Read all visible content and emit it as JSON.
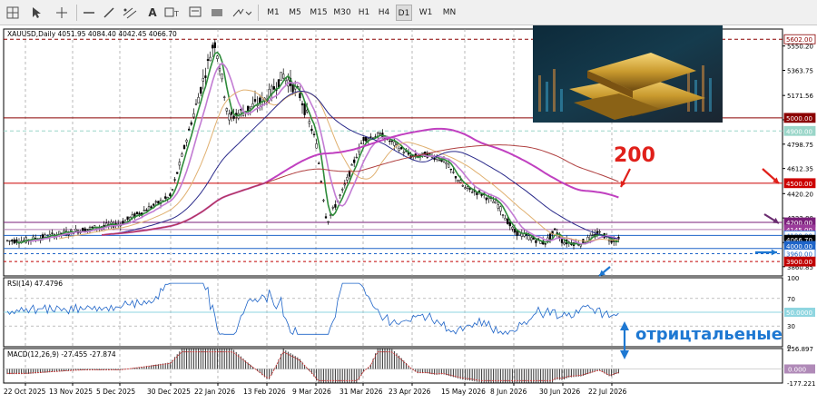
{
  "toolbar": {
    "timeframes": [
      "M1",
      "M5",
      "M15",
      "M30",
      "H1",
      "H4",
      "D1",
      "W1",
      "MN"
    ],
    "active_timeframe": "D1",
    "tool_icons": [
      "grid-icon",
      "cursor-icon",
      "crosshair-icon",
      "hline-icon",
      "trendline-icon",
      "channel-icon",
      "text-icon",
      "shapes-icon",
      "arrow-tool-icon"
    ]
  },
  "chart_header": {
    "symbol_line": "XAUUSD,Daily  4051.95 4084.40 4042.45 4066.70"
  },
  "annotations": {
    "ma_label": "200",
    "side_note": "отрицтальеные"
  },
  "colors": {
    "background": "#ffffff",
    "candle": "#000000",
    "red_line": "#c00000",
    "purple_line": "#800080",
    "level_5000": "#8b0000",
    "level_4500": "#cc0000",
    "level_4200": "#7a1f7a",
    "level_4900": "#9ad6c9",
    "blue_level": "#1e64c8",
    "annotation_red": "#e0201a",
    "annotation_blue": "#1e78d2",
    "annotation_purple": "#6a2c70"
  },
  "price_axis": {
    "ticks": [
      "5550.20",
      "5363.75",
      "5171.56",
      "4985.35",
      "4798.75",
      "4612.35",
      "4420.20",
      "4233.80",
      "4045.40",
      "3860.85"
    ],
    "badges": [
      {
        "text": "5602.00",
        "bg": "#ffffff",
        "fg": "#8b0000",
        "border": "#8b0000"
      },
      {
        "text": "5000.00",
        "bg": "#8b0000",
        "fg": "#ffffff",
        "border": "#8b0000"
      },
      {
        "text": "4900.00",
        "bg": "#9ad6c9",
        "fg": "#ffffff",
        "border": "#9ad6c9"
      },
      {
        "text": "4500.00",
        "bg": "#cc0000",
        "fg": "#ffffff",
        "border": "#cc0000"
      },
      {
        "text": "4200.00",
        "bg": "#7a1f7a",
        "fg": "#ffffff",
        "border": "#7a1f7a"
      },
      {
        "text": "4145.00",
        "bg": "#9a3b9a",
        "fg": "#ffffff",
        "border": "#9a3b9a"
      },
      {
        "text": "4100.00",
        "bg": "#ffffff",
        "fg": "#1e64c8",
        "border": "#1e64c8"
      },
      {
        "text": "4066.70",
        "bg": "#000000",
        "fg": "#ffffff",
        "border": "#000000"
      },
      {
        "text": "4000.00",
        "bg": "#1e64c8",
        "fg": "#ffffff",
        "border": "#1e64c8"
      },
      {
        "text": "3960.00",
        "bg": "#ffffff",
        "fg": "#1e64c8",
        "border": "#1e64c8"
      },
      {
        "text": "3900.00",
        "bg": "#c00000",
        "fg": "#ffffff",
        "border": "#c00000"
      }
    ]
  },
  "rsi": {
    "label": "RSI(14) 47.4796",
    "ticks": [
      "100",
      "70",
      "30",
      "0"
    ],
    "level_badge": "50.0000"
  },
  "macd": {
    "label": "MACD(12,26,9) -27.455 -27.874",
    "ticks": [
      "256.897",
      "-177.221"
    ],
    "zero_badge": "0.000"
  },
  "time_axis": {
    "labels": [
      "22 Oct 2025",
      "13 Nov 2025",
      "5 Dec 2025",
      "30 Dec 2025",
      "22 Jan 2026",
      "13 Feb 2026",
      "9 Mar 2026",
      "31 Mar 2026",
      "23 Apr 2026",
      "15 May 2026",
      "8 Jun 2026",
      "30 Jun 2026",
      "22 Jul 2026"
    ]
  },
  "chart_data": {
    "type": "candlestick",
    "symbol": "XAUUSD",
    "timeframe": "Daily",
    "ohlc_last": {
      "open": 4051.95,
      "high": 4084.4,
      "low": 4042.45,
      "close": 4066.7
    },
    "ylim": [
      3790,
      5680
    ],
    "horizontal_levels": [
      5602,
      5000,
      4900,
      4500,
      4200,
      4145,
      4100,
      4000,
      3960,
      3900
    ],
    "close_series": {
      "x": [
        "22 Oct 2025",
        "13 Nov 2025",
        "5 Dec 2025",
        "30 Dec 2025",
        "22 Jan 2026",
        "13 Feb 2026",
        "9 Mar 2026",
        "31 Mar 2026",
        "23 Apr 2026",
        "15 May 2026",
        "8 Jun 2026",
        "30 Jun 2026",
        "22 Jul 2026"
      ],
      "y": [
        4060,
        4130,
        4190,
        4400,
        5480,
        5150,
        4820,
        4840,
        4700,
        4460,
        4130,
        4050,
        4066.7
      ]
    },
    "rsi": {
      "value": 47.4796,
      "range": [
        0,
        100
      ],
      "levels": [
        70,
        50,
        30
      ]
    },
    "macd": {
      "main": -27.455,
      "signal": -27.874,
      "range": [
        -177.221,
        256.897
      ]
    }
  }
}
